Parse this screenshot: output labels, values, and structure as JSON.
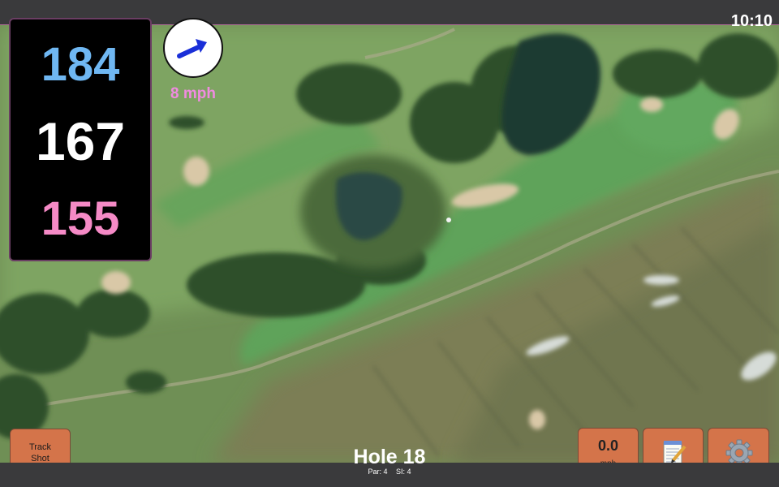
{
  "status": {
    "time": "10:10"
  },
  "distances": {
    "back": "184",
    "middle": "167",
    "front": "155"
  },
  "wind": {
    "speed": "8 mph",
    "icon": "wind-arrow-icon",
    "color": "#1a2fd8"
  },
  "buttons": {
    "track_shot": "Track\nShot",
    "speed_value": "0.0",
    "speed_unit": "mph",
    "notes_icon": "notepad-icon",
    "settings_icon": "gear-icon"
  },
  "hole": {
    "title": "Hole 18",
    "par": "Par: 4",
    "si": "SI: 4"
  },
  "colors": {
    "back_distance": "#6fb7f2",
    "middle_distance": "#ffffff",
    "front_distance": "#f58ac6",
    "wind_text": "#f08be0",
    "button": "#d4744a"
  }
}
